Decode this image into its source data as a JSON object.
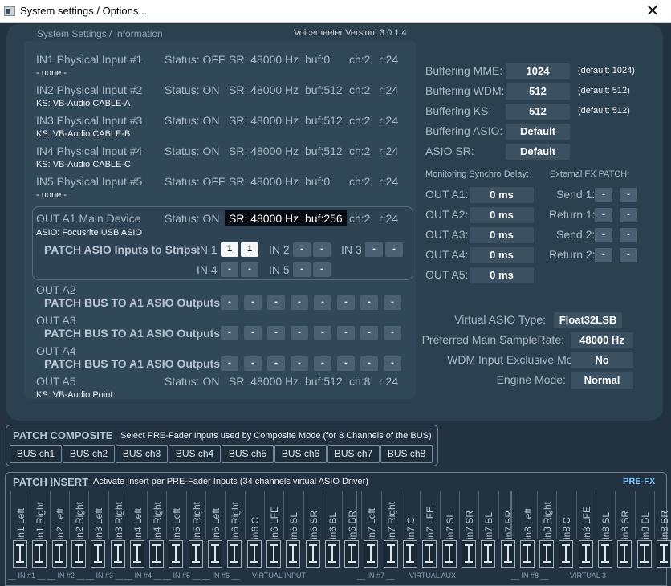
{
  "window": {
    "title": "System settings / Options...",
    "close_icon": "close-icon"
  },
  "header": {
    "section": "System Settings / Information",
    "version": "Voicemeeter Version: 3.0.1.4"
  },
  "inputs": [
    {
      "name": "IN1 Physical Input #1",
      "status": "Status: OFF",
      "sr": "SR: 48000 Hz",
      "buf": "buf:0",
      "ch": "ch:2",
      "r": "r:24",
      "device": "- none -"
    },
    {
      "name": "IN2 Physical Input #2",
      "status": "Status: ON",
      "sr": "SR: 48000 Hz",
      "buf": "buf:512",
      "ch": "ch:2",
      "r": "r:24",
      "device": "KS: VB-Audio CABLE-A"
    },
    {
      "name": "IN3 Physical Input #3",
      "status": "Status: ON",
      "sr": "SR: 48000 Hz",
      "buf": "buf:512",
      "ch": "ch:2",
      "r": "r:24",
      "device": "KS: VB-Audio CABLE-B"
    },
    {
      "name": "IN4 Physical Input #4",
      "status": "Status: ON",
      "sr": "SR: 48000 Hz",
      "buf": "buf:512",
      "ch": "ch:2",
      "r": "r:24",
      "device": "KS: VB-Audio CABLE-C"
    },
    {
      "name": "IN5 Physical Input #5",
      "status": "Status: OFF",
      "sr": "SR: 48000 Hz",
      "buf": "buf:0",
      "ch": "ch:2",
      "r": "r:24",
      "device": "- none -"
    }
  ],
  "outA1": {
    "name": "OUT A1 Main Device",
    "status": "Status: ON",
    "sr": "SR: 48000 Hz",
    "buf": "buf:256",
    "ch": "ch:2",
    "r": "r:24",
    "device": "ASIO: Focusrite USB ASIO",
    "patch_label": "PATCH ASIO Inputs to Strips:",
    "ins": [
      {
        "label": "IN 1",
        "v1": "1",
        "v2": "1"
      },
      {
        "label": "IN 2",
        "v1": "-",
        "v2": "-"
      },
      {
        "label": "IN 3",
        "v1": "-",
        "v2": "-"
      },
      {
        "label": "IN 4",
        "v1": "-",
        "v2": "-"
      },
      {
        "label": "IN 5",
        "v1": "-",
        "v2": "-"
      }
    ]
  },
  "outs": [
    {
      "name": "OUT A2",
      "patch": "PATCH BUS TO A1 ASIO Outputs:"
    },
    {
      "name": "OUT A3",
      "patch": "PATCH BUS TO A1 ASIO Outputs:"
    },
    {
      "name": "OUT A4",
      "patch": "PATCH BUS TO A1 ASIO Outputs:"
    }
  ],
  "patch_value": "-",
  "outA5": {
    "name": "OUT A5",
    "status": "Status: ON",
    "sr": "SR: 48000 Hz",
    "buf": "buf:512",
    "ch": "ch:8",
    "r": "r:24",
    "device": "KS: VB-Audio Point"
  },
  "buffering": [
    {
      "label": "Buffering MME:",
      "value": "1024",
      "default": "(default: 1024)"
    },
    {
      "label": "Buffering WDM:",
      "value": "512",
      "default": "(default: 512)"
    },
    {
      "label": "Buffering KS:",
      "value": "512",
      "default": "(default: 512)"
    },
    {
      "label": "Buffering ASIO:",
      "value": "Default",
      "default": ""
    },
    {
      "label": "ASIO SR:",
      "value": "Default",
      "default": ""
    }
  ],
  "monitoring": {
    "title": "Monitoring Synchro Delay:",
    "rows": [
      {
        "label": "OUT A1:",
        "value": "0 ms"
      },
      {
        "label": "OUT A2:",
        "value": "0 ms"
      },
      {
        "label": "OUT A3:",
        "value": "0 ms"
      },
      {
        "label": "OUT A4:",
        "value": "0 ms"
      },
      {
        "label": "OUT A5:",
        "value": "0 ms"
      }
    ]
  },
  "fx": {
    "title": "External FX PATCH:",
    "rows": [
      {
        "label": "Send 1:",
        "v1": "-",
        "v2": "-"
      },
      {
        "label": "Return 1:",
        "v1": "-",
        "v2": "-"
      },
      {
        "label": "Send 2:",
        "v1": "-",
        "v2": "-"
      },
      {
        "label": "Return 2:",
        "v1": "-",
        "v2": "-"
      }
    ]
  },
  "settings": [
    {
      "label": "Virtual ASIO Type:",
      "value": "Float32LSB"
    },
    {
      "label": "Preferred Main SampleRate:",
      "value": "48000 Hz"
    },
    {
      "label": "WDM Input Exclusive Mode:",
      "value": "No"
    },
    {
      "label": "Engine Mode:",
      "value": "Normal"
    }
  ],
  "composite": {
    "title": "PATCH COMPOSITE",
    "desc": "Select PRE-Fader Inputs used by Composite Mode (for 8 Channels of the BUS)",
    "buses": [
      "BUS ch1",
      "BUS ch2",
      "BUS ch3",
      "BUS ch4",
      "BUS ch5",
      "BUS ch6",
      "BUS ch7",
      "BUS ch8"
    ]
  },
  "insert": {
    "title": "PATCH INSERT",
    "desc": "Activate Insert per PRE-Fader Inputs (34 channels virtual ASIO Driver)",
    "prefx": "PRE-FX",
    "channels": [
      "in1 Left",
      "in1 Right",
      "in2 Left",
      "in2 Right",
      "in3 Left",
      "in3 Right",
      "in4 Left",
      "in4 Right",
      "in5 Left",
      "in5 Right",
      "in6 Left",
      "in6 Right",
      "in6 C",
      "in6 LFE",
      "in6 SL",
      "in6 SR",
      "in6 BL",
      "in6 BR",
      "in7 Left",
      "in7 Right",
      "in7 C",
      "in7 LFE",
      "in7 SL",
      "in7 SR",
      "in7 BL",
      "in7 BR",
      "in8 Left",
      "in8 Right",
      "in8 C",
      "in8 LFE",
      "in8 SL",
      "in8 SR",
      "in8 BL",
      "in8 BR"
    ],
    "groups": [
      "__ IN #1 __",
      "__ IN #2 __",
      "__ IN #3 __",
      "__ IN #4 __",
      "__ IN #5 __",
      "__ IN #6 __",
      "VIRTUAL INPUT",
      "__ IN #7 __",
      "VIRTUAL AUX",
      "__ IN #8 __",
      "VIRTUAL 3"
    ]
  }
}
